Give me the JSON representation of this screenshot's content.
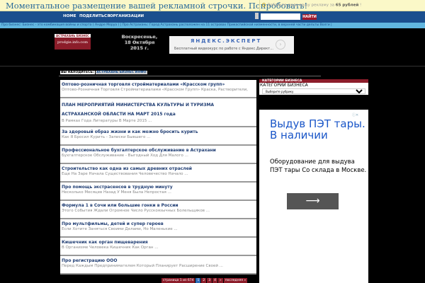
{
  "topbar": {
    "promo": "Моментальное размещение вашей рекламной строчки. Попробовать!",
    "add_text": "Добавьте сюда вашу рекламу за",
    "add_price": "65 рублей",
    "add_tail": "!"
  },
  "nav": {
    "items": [
      "HOME",
      "ПОДЕЛИТЬСЯ",
      "ОРГАНИЗАЦИИ"
    ],
    "search_button": "НАЙТИ",
    "search_placeholder": ""
  },
  "ticker": "Про бизнес: Бизнес - это комбинация войны и спорта ( Андре Моруа ) | Про Астрахань: Город Астрахань расположен на 11 островах Прикаспийской низменности, в верхней части дельты Волги |",
  "logo": {
    "top": "АСТРАХАНЬ БИЗНЕС ИНФО",
    "text": "prodgie.info.com"
  },
  "date": "Воскресенье, 18 Октября 2015 г.",
  "yandex_ad": {
    "title": "ЯНДЕКС.ЭКСПЕРТ",
    "desc": "Бесплатный видеокурс по работе с Яндекс.Директ...",
    "arrow": "›"
  },
  "breadcrumb": {
    "label": "ВЫ НАХОДИТЕСЬ:",
    "current": "АСТРАХАНЬ БИЗНЕС ИНФО"
  },
  "articles": [
    {
      "title": "Оптово-розничная торговля стройматериалами «Красском групп»",
      "desc": "Оптово-Розничная Торговля Стройматериалами «Красском Групп» Краска, Растворители,"
    },
    {
      "title": "ПЛАН МЕРОПРИЯТИЙ МИНИСТЕРСТВА КУЛЬТУРЫ И ТУРИЗМА АСТРАХАНСКОЙ ОБЛАСТИ НА МАРТ 2015 года",
      "desc": "В Рамках Года Литературы В Марте 2015 ..."
    },
    {
      "title": "За здоровый образ жизни и как можно бросить курить",
      "desc": "Как Я Бросил Курить - Записки Бывшего ..."
    },
    {
      "title": "Профессиональное бухгалтерское обслуживание в Астрахани",
      "desc": "Бухгалтерское Обслуживание - Выгодный Ход Для Малого ..."
    },
    {
      "title": "Строительство как одна из самых древних отраслей",
      "desc": "Еще На Заре Начала Существования Человечество Начало ..."
    },
    {
      "title": "Про помощь экстрасенсов в трудную минуту",
      "desc": "Несколько Месяцев Назад У Меня Была Непростая ..."
    },
    {
      "title": "Формула 1 в Сочи или большие гонки в России",
      "desc": "Этого События Ждали Огромное Число Русскоязычных Болельщиков ..."
    },
    {
      "title": "Про мультфильмы, детей и супер героев",
      "desc": "Если Хотите Заняться Своими Делами, Но Маленькие ..."
    },
    {
      "title": "Кишечник как орган пищеварения",
      "desc": " В Организме Человека Кишечник Как Орган ..."
    },
    {
      "title": "Про регистрацию ООО",
      "desc": "Перед Каждым Предпринимателем Который Планирует Расширение Своей ..."
    }
  ],
  "pager": {
    "info": "страница 1 из 674",
    "pages": [
      "1",
      "2",
      "3",
      "4"
    ],
    "next": "»",
    "last": "последняя »"
  },
  "sidebar": {
    "header": "КАТЕГОРИИ БИЗНЕСА",
    "label": "КАТЕГОРИИ БИЗНЕСА",
    "select": "Выберите рубрику"
  },
  "side_ad": {
    "title": "Выдув ПЭТ тары. В наличии",
    "desc": "Оборудование для выдува ПЭТ тары Со склада в Москве.",
    "arrow": "⟶",
    "adchoices": "ⓘ✕"
  }
}
